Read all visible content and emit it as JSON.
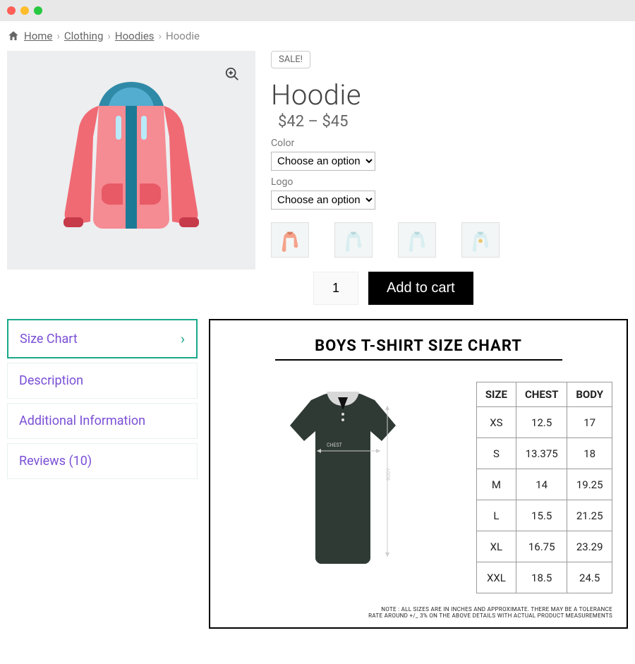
{
  "breadcrumb": {
    "home": "Home",
    "clothing": "Clothing",
    "hoodies": "Hoodies",
    "current": "Hoodie"
  },
  "product": {
    "sale_badge": "SALE!",
    "title": "Hoodie",
    "price": "$42 – $45",
    "color_label": "Color",
    "color_placeholder": "Choose an option",
    "logo_label": "Logo",
    "logo_placeholder": "Choose an option",
    "qty": "1",
    "add_to_cart": "Add to cart"
  },
  "tabs": {
    "size_chart": "Size Chart",
    "description": "Description",
    "additional": "Additional Information",
    "reviews": "Reviews (10)"
  },
  "chart": {
    "title": "BOYS T-SHIRT SIZE CHART",
    "labels": {
      "chest": "CHEST",
      "body": "BODY"
    },
    "note_line1": "NOTE : ALL SIZES ARE IN INCHES AND APPROXIMATE. THERE MAY BE A TOLERANCE",
    "note_line2": "RATE AROUND +/_ 3% ON THE ABOVE DETAILS WITH ACTUAL PRODUCT MEASUREMENTS"
  },
  "chart_data": {
    "type": "table",
    "title": "BOYS T-SHIRT SIZE CHART",
    "columns": [
      "SIZE",
      "CHEST",
      "BODY"
    ],
    "rows": [
      [
        "XS",
        12.5,
        17
      ],
      [
        "S",
        13.375,
        18
      ],
      [
        "M",
        14,
        19.25
      ],
      [
        "L",
        15.5,
        21.25
      ],
      [
        "XL",
        16.75,
        23.29
      ],
      [
        "XXL",
        18.5,
        24.5
      ]
    ]
  }
}
